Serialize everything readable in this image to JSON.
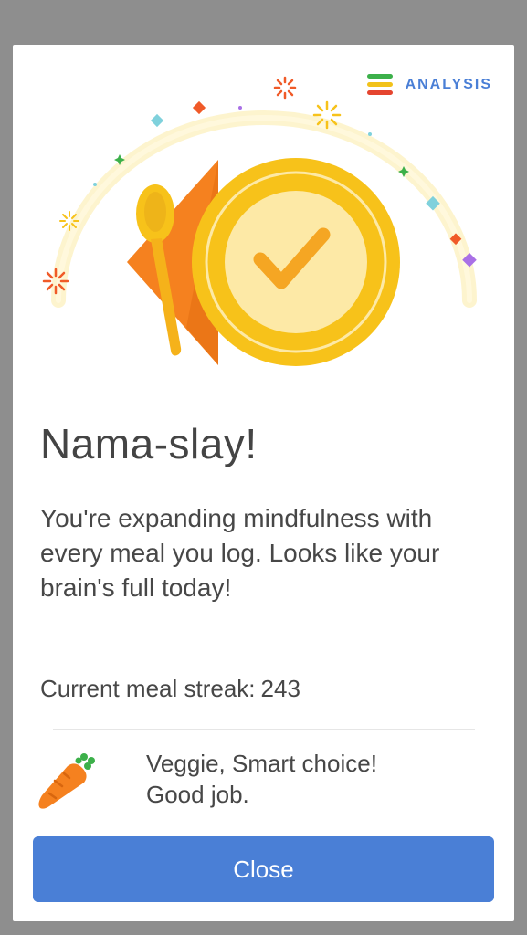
{
  "header": {
    "analysis_label": "ANALYSIS",
    "analysis_icon": "analysis-bars-icon",
    "analysis_icon_colors": [
      "#3cb04a",
      "#f2c21a",
      "#e5452f"
    ]
  },
  "illustration": {
    "icons": [
      "spoon-icon",
      "plate-icon",
      "checkmark-icon",
      "napkin-icon",
      "confetti-icon",
      "sparkle-icon"
    ],
    "colors": {
      "plate": "#f7c21a",
      "plate_inner": "#fde9a6",
      "napkin": "#f5811f",
      "check": "#f5a623",
      "glow": "#fdf1c2"
    }
  },
  "main": {
    "title": "Nama-slay!",
    "message": "You're expanding mindfulness with every meal you log. Looks like your brain's full today!",
    "streak_label": "Current meal streak:",
    "streak_value": "243",
    "veggie_line1": "Veggie, Smart choice!",
    "veggie_line2": "Good job.",
    "veggie_icon": "carrot-icon"
  },
  "footer": {
    "close_label": "Close"
  },
  "colors": {
    "accent": "#4a7fd6",
    "backdrop": "#8e8e8e",
    "text": "#474747"
  }
}
